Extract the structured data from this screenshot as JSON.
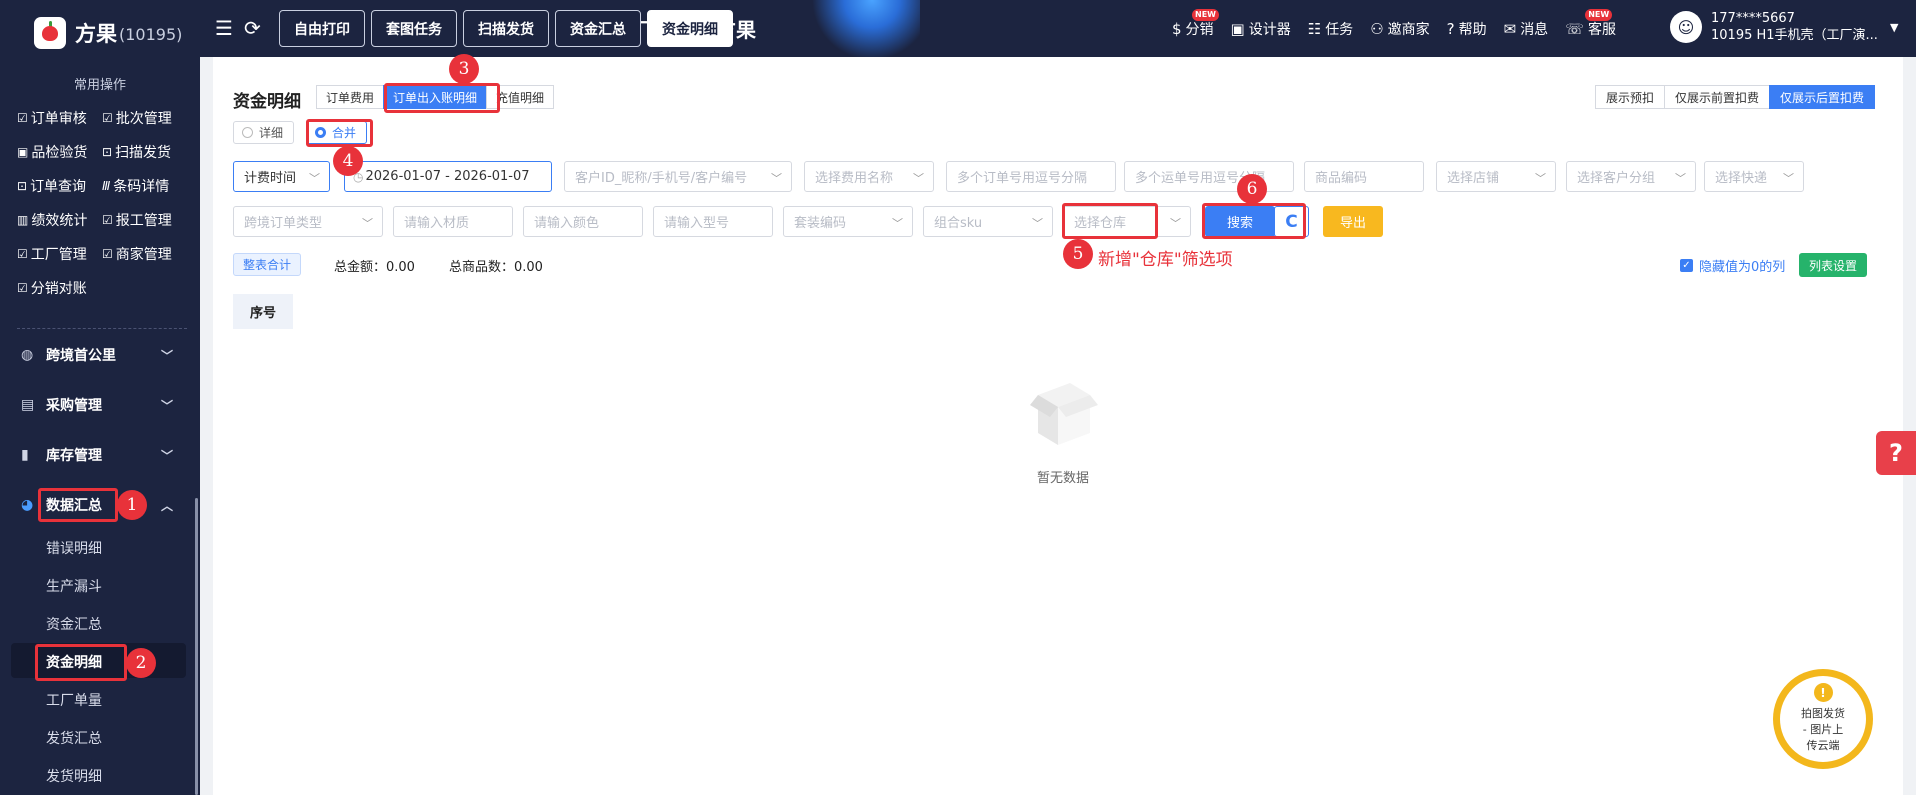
{
  "brand": {
    "name": "方果",
    "id": "(10195)"
  },
  "banner_text": "厂，选用方果",
  "top_tabs": [
    "自由打印",
    "套图任务",
    "扫描发货",
    "资金汇总",
    "资金明细"
  ],
  "top_right": [
    {
      "label": "分销",
      "icon": "distribution-icon",
      "badge": "NEW"
    },
    {
      "label": "设计器",
      "icon": "image-icon"
    },
    {
      "label": "任务",
      "icon": "task-icon"
    },
    {
      "label": "邀商家",
      "icon": "invite-icon"
    },
    {
      "label": "帮助",
      "icon": "help-icon"
    },
    {
      "label": "消息",
      "icon": "message-icon"
    },
    {
      "label": "客服",
      "icon": "service-icon",
      "badge": "NEW"
    }
  ],
  "user": {
    "phone": "177****5667",
    "account": "10195  H1手机壳（工厂演..."
  },
  "sidebar": {
    "title": "常用操作",
    "quick_ops": [
      [
        "订单审核",
        "批次管理"
      ],
      [
        "品检验货",
        "扫描发货"
      ],
      [
        "订单查询",
        "条码详情"
      ],
      [
        "绩效统计",
        "报工管理"
      ],
      [
        "工厂管理",
        "商家管理"
      ],
      [
        "分销对账"
      ]
    ],
    "groups": [
      {
        "label": "跨境首公里",
        "icon": "globe-icon",
        "expanded": false
      },
      {
        "label": "采购管理",
        "icon": "store-icon",
        "expanded": false
      },
      {
        "label": "库存管理",
        "icon": "inventory-icon",
        "expanded": false
      },
      {
        "label": "数据汇总",
        "icon": "pie-chart-icon",
        "expanded": true
      }
    ],
    "sub_items": [
      "错误明细",
      "生产漏斗",
      "资金汇总",
      "资金明细",
      "工厂单量",
      "发货汇总",
      "发货明细"
    ],
    "active_sub": "资金明细"
  },
  "page": {
    "title": "资金明细",
    "subtabs": [
      "订单费用",
      "订单出入账明细",
      "充值明细"
    ],
    "radios": [
      "详细",
      "合并"
    ],
    "view_buttons": [
      "展示预扣",
      "仅展示前置扣费",
      "仅展示后置扣费"
    ],
    "filters_row1": {
      "time_type": "计费时间",
      "date_range": "2026-01-07 - 2026-01-07",
      "customer": "客户ID_昵称/手机号/客户编号",
      "fee_name": "选择费用名称",
      "order_nos": "多个订单号用逗号分隔",
      "waybill_nos": "多个运单号用逗号分隔",
      "product_code": "商品编码",
      "shop": "选择店铺",
      "customer_group": "选择客户分组",
      "express": "选择快递"
    },
    "filters_row2": {
      "cross_order_type": "跨境订单类型",
      "material": "请输入材质",
      "color": "请输入颜色",
      "model": "请输入型号",
      "bundle_code": "套装编码",
      "combo_sku": "组合sku",
      "warehouse": "选择仓库"
    },
    "buttons": {
      "search": "搜索",
      "export": "导出"
    },
    "summary": {
      "tag": "整表合计",
      "total_amount": "总金额：0.00",
      "total_count": "总商品数：0.00"
    },
    "hide_zero": "隐藏值为0的列",
    "column_settings": "列表设置",
    "table": {
      "columns": [
        "序号"
      ],
      "rows": [],
      "empty_text": "暂无数据"
    }
  },
  "annotations": {
    "steps": [
      "1",
      "2",
      "3",
      "4",
      "5",
      "6"
    ],
    "note": "新增\"仓库\"筛选项"
  },
  "floating": {
    "help": "?",
    "photo_text": "拍图发货\n- 图片上\n传云端"
  },
  "colors": {
    "nav_bg": "#1c2440",
    "primary": "#3b7ef4",
    "highlight": "#e8323a",
    "export": "#f8b81f",
    "success": "#26b36b"
  }
}
